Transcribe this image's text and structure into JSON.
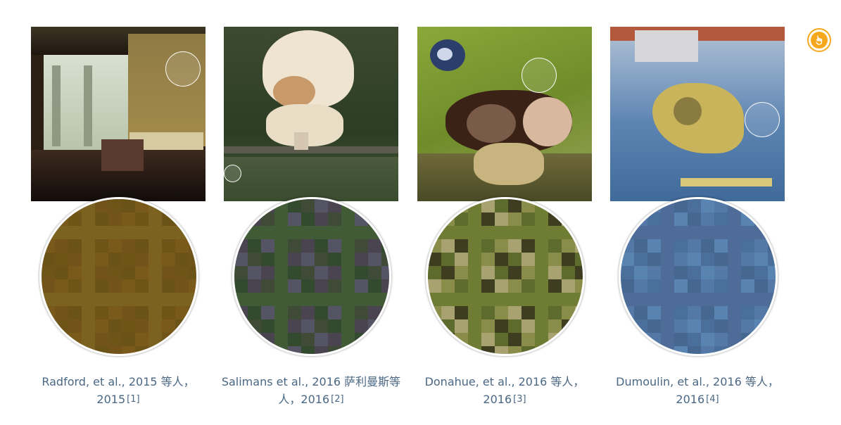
{
  "figures": [
    {
      "caption": "Radford, et al., 2015 等人，2015",
      "ref": "[1]",
      "zoom_colors": [
        "#6f5417",
        "#7a5a1b",
        "#72541a",
        "#6b5217",
        "#7c6220"
      ]
    },
    {
      "caption": "Salimans et al., 2016 萨利曼斯等人，2016",
      "ref": "[2]",
      "zoom_colors": [
        "#3f4a37",
        "#4a4350",
        "#344a2e",
        "#545464",
        "#425b37"
      ]
    },
    {
      "caption": "Donahue, et al., 2016 等人，2016",
      "ref": "[3]",
      "zoom_colors": [
        "#5d6b2c",
        "#8a8c49",
        "#a8a170",
        "#3e3d1f",
        "#6f7c34"
      ]
    },
    {
      "caption": "Dumoulin, et al., 2016 等人，2016",
      "ref": "[4]",
      "zoom_colors": [
        "#4b6f9b",
        "#5479a6",
        "#466790",
        "#5983b0",
        "#4f6c98"
      ]
    }
  ],
  "hand_button": {
    "icon": "pointing-hand-icon",
    "color": "#f5a81c"
  }
}
